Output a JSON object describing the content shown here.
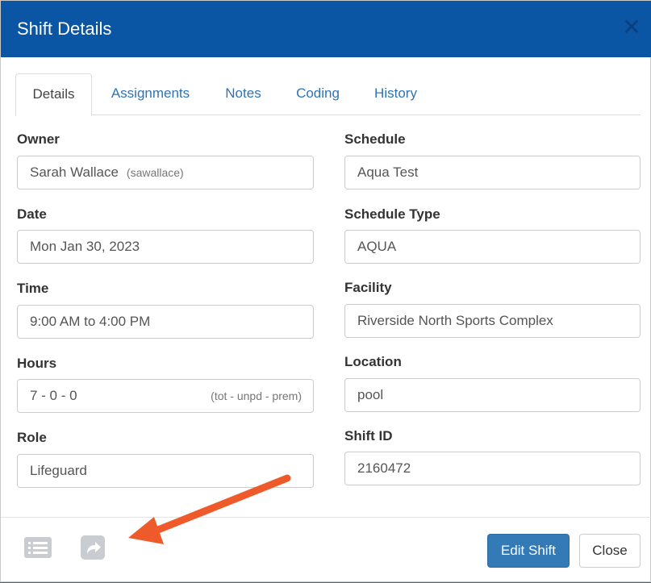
{
  "modal": {
    "title": "Shift Details",
    "close_icon": "close-x-icon"
  },
  "tabs": [
    {
      "label": "Details",
      "active": true
    },
    {
      "label": "Assignments",
      "active": false
    },
    {
      "label": "Notes",
      "active": false
    },
    {
      "label": "Coding",
      "active": false
    },
    {
      "label": "History",
      "active": false
    }
  ],
  "fields": {
    "owner": {
      "label": "Owner",
      "value": "Sarah Wallace",
      "sub": "(sawallace)"
    },
    "date": {
      "label": "Date",
      "value": "Mon Jan 30, 2023"
    },
    "time": {
      "label": "Time",
      "value": "9:00 AM to 4:00 PM"
    },
    "hours": {
      "label": "Hours",
      "value": "7 - 0 - 0",
      "hint": "(tot - unpd - prem)"
    },
    "role": {
      "label": "Role",
      "value": "Lifeguard"
    },
    "schedule": {
      "label": "Schedule",
      "value": "Aqua Test"
    },
    "schedule_type": {
      "label": "Schedule Type",
      "value": "AQUA"
    },
    "facility": {
      "label": "Facility",
      "value": "Riverside North Sports Complex"
    },
    "location": {
      "label": "Location",
      "value": "pool"
    },
    "shift_id": {
      "label": "Shift ID",
      "value": "2160472"
    }
  },
  "footer": {
    "list_icon": "list-icon",
    "share_icon": "share-arrow-icon",
    "edit_label": "Edit Shift",
    "close_label": "Close"
  },
  "colors": {
    "header": "#0a55a4",
    "primary_button": "#337ab7",
    "tab_link": "#2f73b3",
    "annotation_arrow": "#ef5a2a"
  }
}
